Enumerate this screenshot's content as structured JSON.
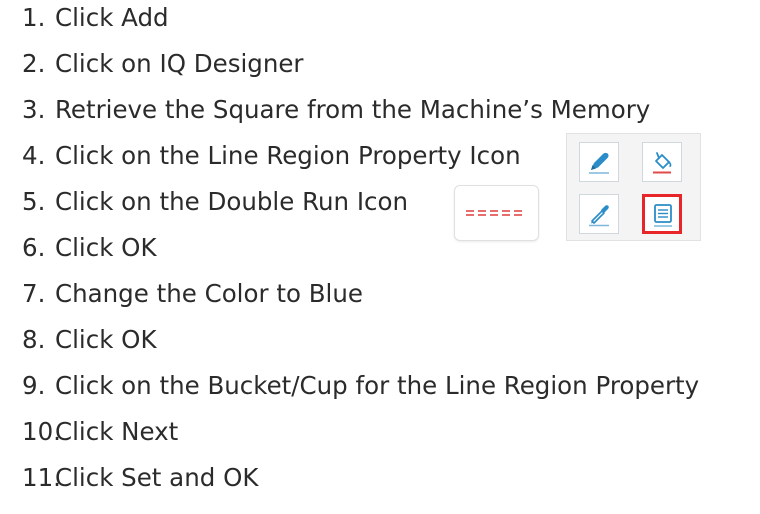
{
  "steps": [
    {
      "num": "1.",
      "text": "Click Add"
    },
    {
      "num": "2.",
      "text": "Click on IQ Designer"
    },
    {
      "num": "3.",
      "text": "Retrieve the Square from the Machine’s Memory"
    },
    {
      "num": "4.",
      "text": "Click on the Line Region Property Icon"
    },
    {
      "num": "5.",
      "text": "Click on the Double Run Icon"
    },
    {
      "num": "6.",
      "text": "Click OK"
    },
    {
      "num": "7.",
      "text": "Change the Color to Blue"
    },
    {
      "num": "8.",
      "text": "Click OK"
    },
    {
      "num": "9.",
      "text": "Click on the Bucket/Cup for the Line Region Property"
    },
    {
      "num": "10.",
      "text": "Click Next"
    },
    {
      "num": "11.",
      "text": "Click Set and OK"
    }
  ],
  "icons": {
    "pen_icon": "pen-icon",
    "fill_bucket_icon": "fill-bucket-icon",
    "eyedropper_icon": "eyedropper-icon",
    "line_region_property_icon": "line-region-property-icon",
    "double_run_icon": "double-run-icon"
  },
  "colors": {
    "icon_blue": "#2a8cc8",
    "highlight_red": "#e8262a",
    "double_run_red": "#e04a4a",
    "text": "#2b2b2b"
  }
}
